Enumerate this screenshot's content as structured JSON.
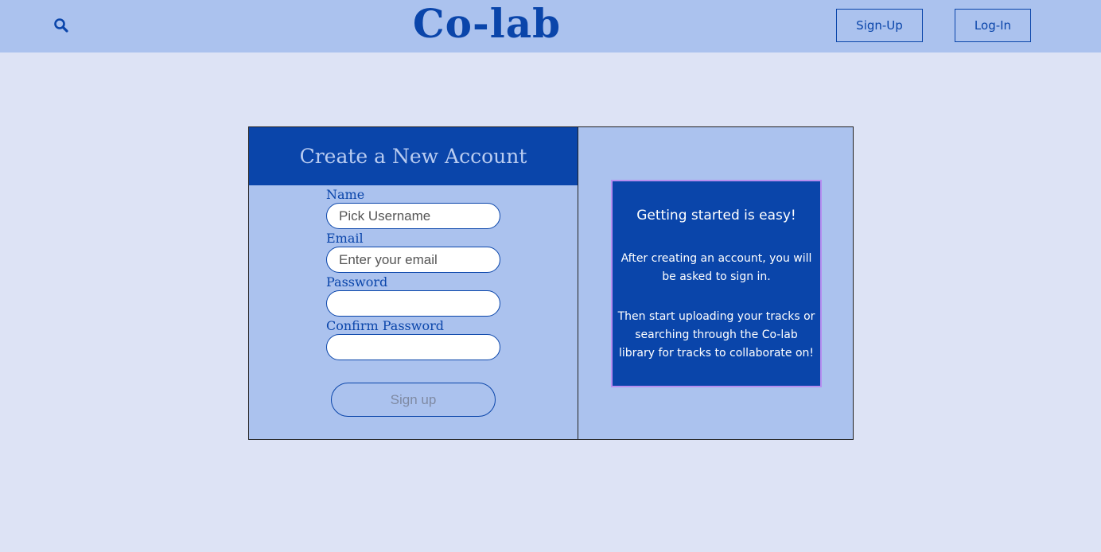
{
  "header": {
    "logo": "Co-lab",
    "search_icon": "search-icon",
    "signup_label": "Sign-Up",
    "login_label": "Log-In"
  },
  "form": {
    "title": "Create a New Account",
    "fields": [
      {
        "label": "Name",
        "placeholder": "Pick Username",
        "value": ""
      },
      {
        "label": "Email",
        "placeholder": "Enter your email",
        "value": ""
      },
      {
        "label": "Password",
        "placeholder": "",
        "value": ""
      },
      {
        "label": "Confirm Password",
        "placeholder": "",
        "value": ""
      }
    ],
    "submit_label": "Sign up"
  },
  "info": {
    "heading": "Getting started is easy!",
    "paragraph1": "After creating an account, you will be asked to sign in.",
    "paragraph2": "Then start uploading your tracks or searching through the Co-lab library for tracks to collaborate on!"
  },
  "colors": {
    "brand": "#0a45aa",
    "header_bg": "#abc2ee",
    "page_bg": "#dde3f5",
    "info_border": "#b68ef0"
  }
}
